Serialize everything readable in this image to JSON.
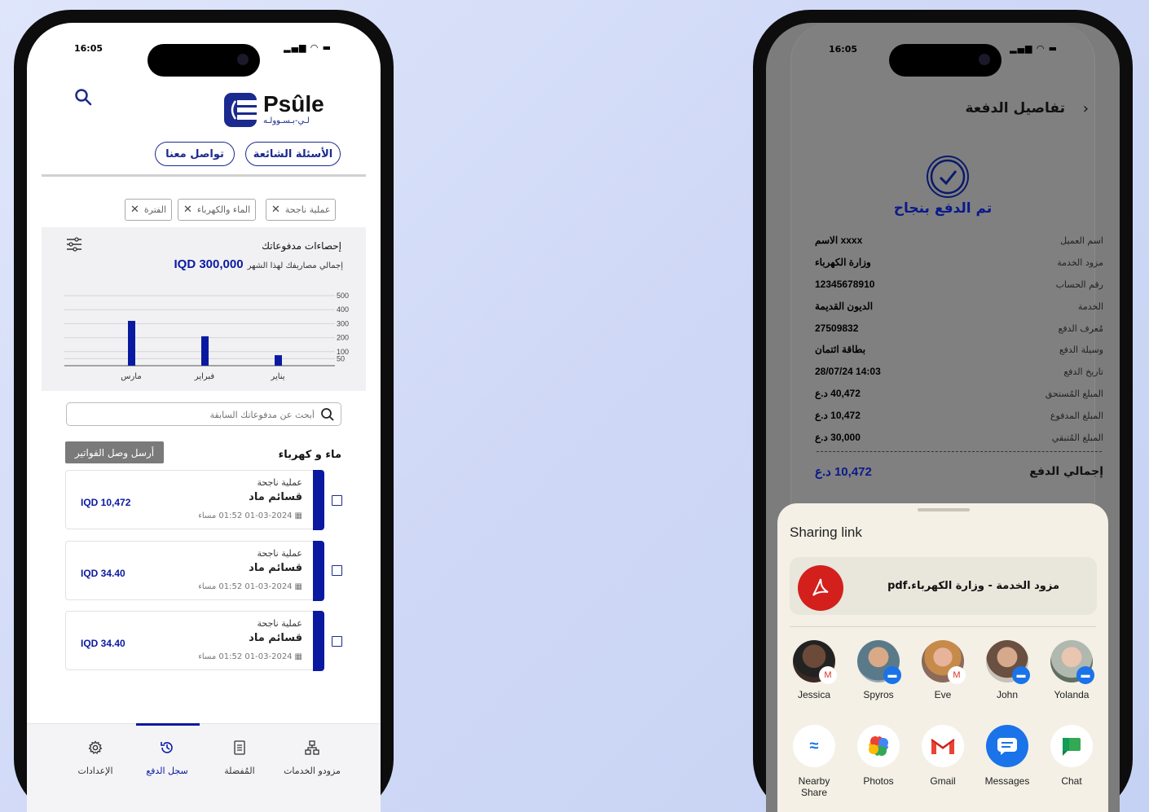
{
  "left": {
    "status": {
      "time": "16:05",
      "signal": "▐▐ ◉ ▬"
    },
    "brand": {
      "name": "Psûle",
      "tagline": "لـي-بـسـوولـه"
    },
    "buttons": {
      "faq": "الأسئلة الشائعة",
      "contact": "تواصل معنا"
    },
    "filters": [
      "عملية ناجحة",
      "الماء والكهرباء",
      "الفترة"
    ],
    "stats": {
      "title": "إحصاءات مدفوعاتك",
      "total": "IQD 300,000",
      "total_label": "إجمالي مصاريفك لهذا الشهر"
    },
    "chart_data": {
      "type": "bar",
      "categories": [
        "مارس",
        "فبراير",
        "يناير"
      ],
      "values": [
        320,
        210,
        75
      ],
      "yticks": [
        "500",
        "400",
        "300",
        "200",
        "100",
        "50"
      ],
      "ylim": [
        0,
        500
      ],
      "bar_color": "#0a1aa0"
    },
    "search": {
      "placeholder": "أبحث عن مدفوعاتك السابقة"
    },
    "section": {
      "title": "ماء و كهرباء",
      "send_button": "أرسل وصل الفواتير"
    },
    "payments": [
      {
        "amount": "IQD 10,472",
        "status": "عملية ناجحة",
        "name": "قسائم ماد",
        "date": "01-03-2024 01:52 مساء"
      },
      {
        "amount": "IQD 34.40",
        "status": "عملية ناجحة",
        "name": "قسائم ماد",
        "date": "01-03-2024 01:52 مساء"
      },
      {
        "amount": "IQD 34.40",
        "status": "عملية ناجحة",
        "name": "قسائم ماد",
        "date": "01-03-2024 01:52 مساء"
      }
    ],
    "nav": {
      "providers": "مزودو الخدمات",
      "favorites": "المُفضلة",
      "history": "سجل الدفع",
      "settings": "الإعدادات"
    }
  },
  "right": {
    "status": {
      "time": "16:05",
      "signal": "▐▐ ◉ ▬"
    },
    "header": {
      "title": "تفاصيل الدفعة"
    },
    "success": "تم الدفع بنجاح",
    "details": [
      {
        "label": "اسم العميل",
        "value": "xxxx الاسم"
      },
      {
        "label": "مزود الخدمة",
        "value": "وزارة الكهرباء"
      },
      {
        "label": "رقم الحساب",
        "value": "12345678910"
      },
      {
        "label": "الخدمة",
        "value": "الديون القديمة"
      },
      {
        "label": "مُعرف الدفع",
        "value": "27509832"
      },
      {
        "label": "وسيلة الدفع",
        "value": "بطاقة ائتمان"
      },
      {
        "label": "تاريخ الدفع",
        "value": "28/07/24 14:03"
      },
      {
        "label": "المبلغ المُستحق",
        "value": "40,472 د.ع"
      },
      {
        "label": "المبلغ المدفوع",
        "value": "10,472 د.ع"
      },
      {
        "label": "المبلغ المُتبقي",
        "value": "30,000 د.ع"
      }
    ],
    "total": {
      "label": "إجمالي الدفع",
      "value": "10,472 د.ع"
    },
    "sheet": {
      "title": "Sharing link",
      "file": "مزود الخدمة - وزارة الكهرباء.pdf",
      "contacts": [
        "Jessica",
        "Spyros",
        "Eve",
        "John",
        "Yolanda"
      ],
      "apps": [
        "Nearby Share",
        "Photos",
        "Gmail",
        "Messages",
        "Chat"
      ]
    }
  }
}
